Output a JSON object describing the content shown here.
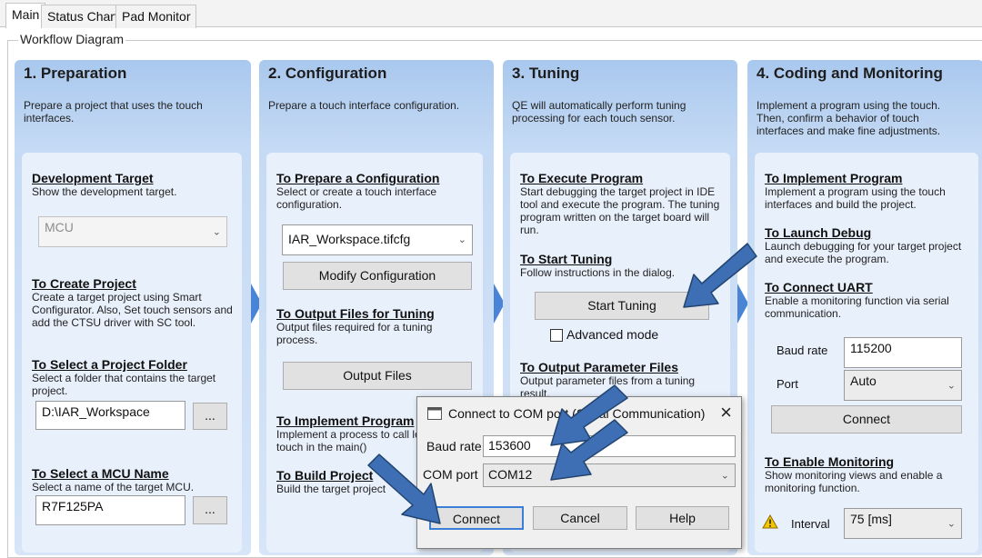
{
  "tabs": [
    "Main",
    "Status Chart",
    "Pad Monitor"
  ],
  "workflow_title": "Workflow Diagram",
  "columns": [
    {
      "title": "1. Preparation",
      "desc": "Prepare a project that uses the touch interfaces.",
      "sections": {
        "dev_target_title": "Development Target",
        "dev_target_desc": "Show the development target.",
        "mcu_value": "MCU",
        "create_project_title": "To Create Project",
        "create_project_desc": "Create a target project using Smart Configurator. Also, Set touch sensors and add the CTSU driver with SC tool.",
        "select_folder_title": "To Select a Project Folder",
        "select_folder_desc": "Select a folder that contains the target project.",
        "folder_value": "D:\\IAR_Workspace",
        "browse_label": "...",
        "mcu_name_title": "To Select a MCU Name",
        "mcu_name_desc": "Select a name of the target MCU.",
        "mcu_name_value": "R7F125PA"
      }
    },
    {
      "title": "2. Configuration",
      "desc": "Prepare a touch interface configuration.",
      "sections": {
        "prepare_title": "To Prepare a Configuration",
        "prepare_desc": "Select or create a touch interface configuration.",
        "config_value": "IAR_Workspace.tifcfg",
        "modify_label": "Modify Configuration",
        "output_title": "To Output Files for Tuning",
        "output_desc": "Output files required for a tuning process.",
        "output_btn": "Output Files",
        "implement_title": "To Implement Program",
        "implement_desc": "Implement a process to call loop for touch in the main()",
        "build_title": "To Build Project",
        "build_desc": "Build the target project"
      }
    },
    {
      "title": "3. Tuning",
      "desc": "QE will automatically perform tuning processing for each touch sensor.",
      "sections": {
        "execute_title": "To Execute Program",
        "execute_desc": "Start debugging the target project in IDE tool and execute the program. The tuning program written on the target board will run.",
        "start_title": "To Start Tuning",
        "start_desc": "Follow instructions in the dialog.",
        "start_btn": "Start Tuning",
        "advanced_label": "Advanced mode",
        "param_title": "To Output Parameter Files",
        "param_desc": "Output parameter files from a tuning result."
      }
    },
    {
      "title": "4. Coding and Monitoring",
      "desc": "Implement a program using the touch. Then, confirm a behavior of touch interfaces and make fine adjustments.",
      "sections": {
        "impl_title": "To Implement Program",
        "impl_desc": "Implement a program using the touch interfaces and build the project.",
        "debug_title": "To Launch Debug",
        "debug_desc": "Launch debugging for your target project and execute the program.",
        "uart_title": "To Connect UART",
        "uart_desc": "Enable a monitoring function via serial communication.",
        "baud_label": "Baud rate",
        "baud_value": "115200",
        "port_label": "Port",
        "port_value": "Auto",
        "connect_label": "Connect",
        "monitor_title": "To Enable Monitoring",
        "monitor_desc": "Show monitoring views and enable a monitoring function.",
        "interval_label": "Interval",
        "interval_value": "75 [ms]"
      }
    }
  ],
  "dialog": {
    "title": "Connect to COM port (Serial Communication)",
    "baud_label": "Baud rate",
    "baud_value": "153600",
    "com_label": "COM port",
    "com_value": "COM12",
    "connect": "Connect",
    "cancel": "Cancel",
    "help": "Help",
    "close_icon": "×"
  },
  "colors": {
    "accent_blue": "#4a84d6",
    "arrow_blue": "#3e6fb5",
    "column_bg": "#c5daf4",
    "warning": "#f4c400"
  }
}
